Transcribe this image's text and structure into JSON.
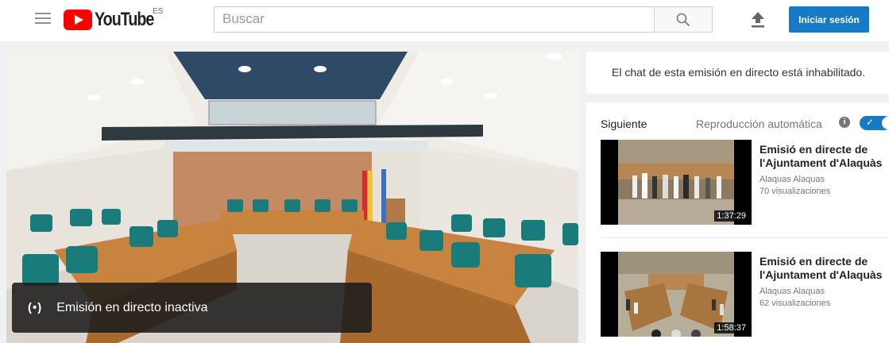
{
  "header": {
    "logo_text": "YouTube",
    "country_code": "ES",
    "search_placeholder": "Buscar",
    "signin_label": "Iniciar sesión"
  },
  "player": {
    "live_status_icon": "(•)",
    "live_status_text": "Emisión en directo inactiva"
  },
  "chat": {
    "message": "El chat de esta emisión en directo está inhabilitado."
  },
  "recommendations": {
    "next_label": "Siguiente",
    "autoplay_label": "Reproducción automática",
    "autoplay_enabled": true,
    "items": [
      {
        "title_line1": "Emisió en directe de",
        "title_line2": "l'Ajuntament d'Alaquàs",
        "channel": "Alaquas Alaquas",
        "views": "70 visualizaciones",
        "duration": "1:37:29"
      },
      {
        "title_line1": "Emisió en directe de",
        "title_line2": "l'Ajuntament d'Alaquàs",
        "channel": "Alaquas Alaquas",
        "views": "62 visualizaciones",
        "duration": "1:58:37"
      }
    ]
  },
  "colors": {
    "brand_red": "#ff0000",
    "accent_blue": "#167ac6"
  }
}
